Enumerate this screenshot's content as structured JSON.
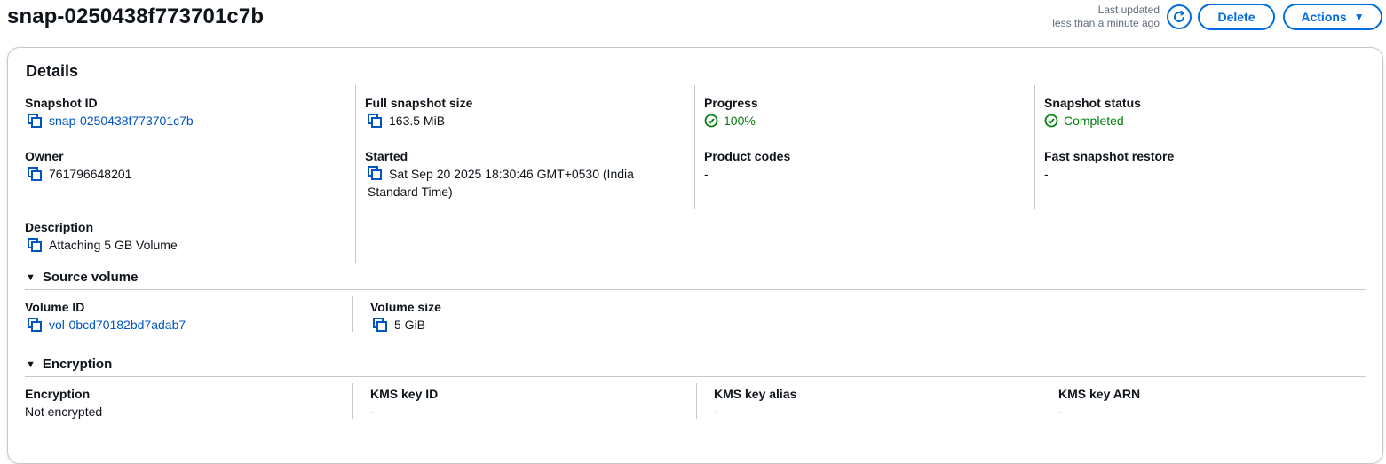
{
  "header": {
    "title": "snap-0250438f773701c7b",
    "last_updated_label": "Last updated",
    "last_updated_value": "less than a minute ago",
    "delete_label": "Delete",
    "actions_label": "Actions",
    "accent_color": "#006ce0"
  },
  "details": {
    "title": "Details",
    "snapshot_id_label": "Snapshot ID",
    "snapshot_id": "snap-0250438f773701c7b",
    "full_size_label": "Full snapshot size",
    "full_size": "163.5 MiB",
    "progress_label": "Progress",
    "progress": "100%",
    "status_label": "Snapshot status",
    "status": "Completed",
    "owner_label": "Owner",
    "owner": "761796648201",
    "started_label": "Started",
    "started": "Sat Sep 20 2025 18:30:46 GMT+0530 (India Standard Time)",
    "product_codes_label": "Product codes",
    "product_codes": "-",
    "fast_restore_label": "Fast snapshot restore",
    "fast_restore": "-",
    "description_label": "Description",
    "description": "Attaching 5 GB Volume"
  },
  "source_volume": {
    "title": "Source volume",
    "volume_id_label": "Volume ID",
    "volume_id": "vol-0bcd70182bd7adab7",
    "volume_size_label": "Volume size",
    "volume_size": "5 GiB"
  },
  "encryption": {
    "title": "Encryption",
    "encryption_label": "Encryption",
    "encryption_value": "Not encrypted",
    "kms_id_label": "KMS key ID",
    "kms_id": "-",
    "kms_alias_label": "KMS key alias",
    "kms_alias": "-",
    "kms_arn_label": "KMS key ARN",
    "kms_arn": "-"
  },
  "icons": {
    "copy": "copy-icon",
    "refresh": "refresh-icon",
    "status_ok": "check-circle-icon",
    "expand": "caret-down-icon"
  },
  "colors": {
    "link": "#0055c0",
    "success": "#037f0c",
    "border": "#c6c6cd"
  }
}
